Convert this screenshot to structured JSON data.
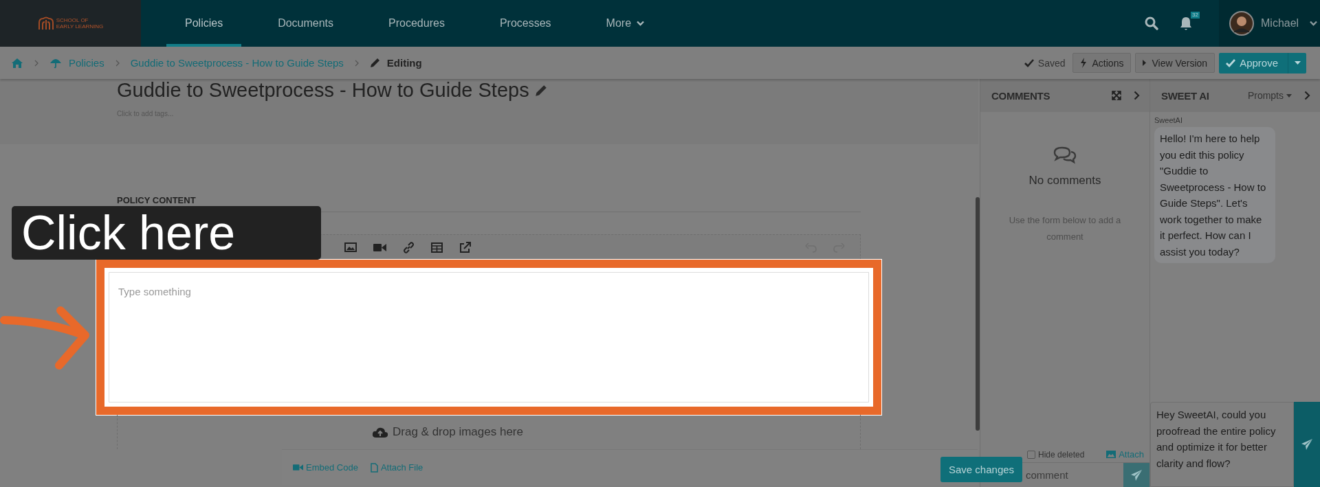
{
  "logo": {
    "line_1": "SCHOOL OF",
    "line_2": "EARLY LEARNING"
  },
  "nav": [
    {
      "label": "Policies",
      "selected": true,
      "dropdown": false
    },
    {
      "label": "Documents",
      "selected": false,
      "dropdown": false
    },
    {
      "label": "Procedures",
      "selected": false,
      "dropdown": false
    },
    {
      "label": "Processes",
      "selected": false,
      "dropdown": false
    },
    {
      "label": "More",
      "selected": false,
      "dropdown": true
    }
  ],
  "notifications": {
    "count": "32"
  },
  "user": {
    "name": "Michael"
  },
  "breadcrumb": {
    "items": [
      "Policies",
      "Guddie to Sweetprocess - How to Guide Steps"
    ],
    "current": "Editing"
  },
  "status": "Saved",
  "toolbar_buttons": [
    "Actions",
    "View Version"
  ],
  "approve": "Approve",
  "document": {
    "title": "Guddie to Sweetprocess - How to Guide Steps",
    "tags_hint": "Click to add tags...",
    "section": "POLICY CONTENT",
    "editor": {
      "placeholder": "Type something"
    },
    "dropzone": "Drag & drop images here",
    "footer_links": [
      "Embed Code",
      "Attach File"
    ],
    "save": "Save changes"
  },
  "comments": {
    "title": "COMMENTS",
    "empty_title": "No comments",
    "empty_hint": "Use the form below to add a comment",
    "hide_deleted": {
      "label": "Hide deleted",
      "checked": false
    },
    "attach": "Attach",
    "input": {
      "placeholder": "comment"
    }
  },
  "ai": {
    "title": "SWEET AI",
    "prompts": "Prompts",
    "messages": [
      {
        "sender": "SweetAI",
        "text": "Hello! I'm here to help you edit this policy \"Guddie to Sweetprocess - How to Guide Steps\". Let's work together to make it perfect. How can I assist you today?"
      }
    ],
    "input": {
      "value": "Hey SweetAI, could you proofread the entire policy and optimize it for better clarity and flow?"
    }
  },
  "callout": {
    "text": "Click here"
  }
}
